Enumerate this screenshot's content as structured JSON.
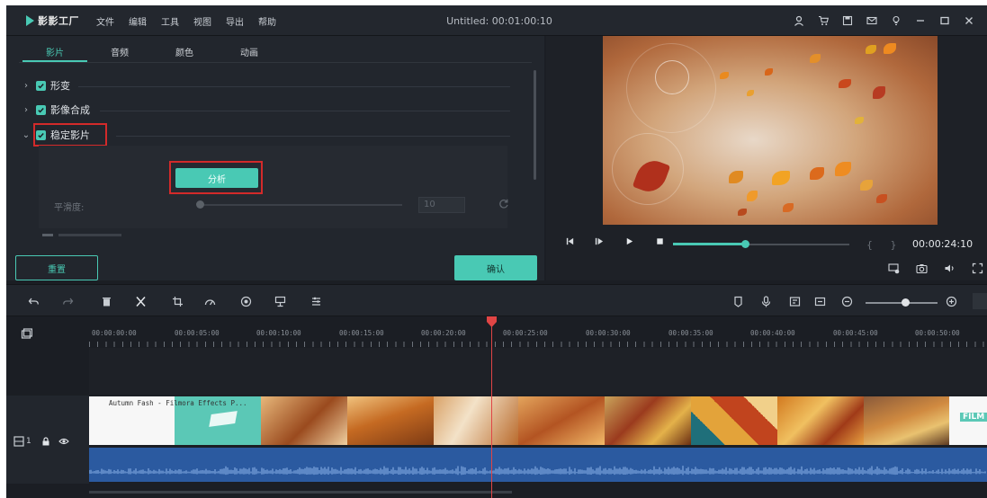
{
  "app": {
    "logo_text": "影影工厂",
    "title": "Untitled: 00:01:00:10",
    "menu": [
      "文件",
      "编辑",
      "工具",
      "视图",
      "导出",
      "帮助"
    ]
  },
  "title_icons": [
    "user-icon",
    "cart-icon",
    "save-icon",
    "mail-icon",
    "bulb-icon",
    "minimize-icon",
    "maximize-icon",
    "close-icon"
  ],
  "left_panel": {
    "tabs": [
      {
        "label": "影片",
        "active": true
      },
      {
        "label": "音频",
        "active": false
      },
      {
        "label": "颜色",
        "active": false
      },
      {
        "label": "动画",
        "active": false
      }
    ],
    "sections": [
      {
        "label": "形变",
        "expanded": false,
        "checked": true
      },
      {
        "label": "影像合成",
        "expanded": false,
        "checked": true
      },
      {
        "label": "稳定影片",
        "expanded": true,
        "checked": true
      }
    ],
    "analyze_label": "分析",
    "smoothness_label": "平滑度:",
    "smoothness_value": "10",
    "reset_label": "重置",
    "ok_label": "确认"
  },
  "preview": {
    "timecode": "00:00:24:10",
    "braces": "{ }",
    "progress": 0.41
  },
  "timeline": {
    "ruler": [
      "00:00:00:00",
      "00:00:05:00",
      "00:00:10:00",
      "00:00:15:00",
      "00:00:20:00",
      "00:00:25:00",
      "00:00:30:00",
      "00:00:35:00",
      "00:00:40:00",
      "00:00:45:00",
      "00:00:50:00"
    ],
    "track_label": "1",
    "clip_title": "Autumn Fash - Filmora Effects P...",
    "end_clip_text": "FILM"
  },
  "colors": {
    "accent": "#49c9b4",
    "highlight": "#d32a2a",
    "playhead": "#e04545",
    "audio": "#2b5aa0"
  }
}
